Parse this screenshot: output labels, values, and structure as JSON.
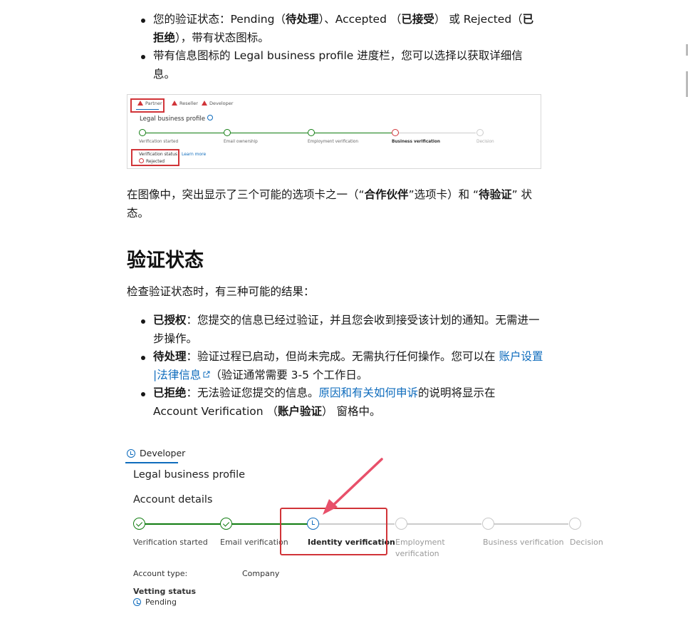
{
  "top_bullets": [
    {
      "p1": "您的验证状态：Pending（",
      "b1": "待处理",
      "p2": "）、Accepted （",
      "b2": "已接受",
      "p3": "） 或 Rejected（",
      "b3": "已拒绝",
      "p4": "），带有状态图标。"
    },
    {
      "text": "带有信息图标的 Legal business profile 进度栏，您可以选择以获取详细信息。"
    }
  ],
  "screenshot1": {
    "tabs": [
      "Partner",
      "Reseller",
      "Developer"
    ],
    "title": "Legal business profile",
    "steps": [
      "Verification started",
      "Email ownership",
      "Employment verification",
      "Business verification",
      "Decision"
    ],
    "status_label": "Verification status",
    "learn_more": "Learn more",
    "status_value": "Rejected"
  },
  "caption": {
    "p1": "在图像中，突出显示了三个可能的选项卡之一（“",
    "b1": "合作伙伴",
    "p2": "”选项卡）和 “",
    "b2": "待验证",
    "p3": "” 状态。"
  },
  "heading": "验证状态",
  "intro": "检查验证状态时，有三种可能的结果：",
  "results": [
    {
      "term": "已授权",
      "text": "：您提交的信息已经过验证，并且您会收到接受该计划的通知。无需进一步操作。"
    },
    {
      "term": "待处理",
      "text1": "：验证过程已启动，但尚未完成。无需执行任何操作。您可以在 ",
      "link": "账户设置 |法律信息",
      "text2": "（验证通常需要 3-5 个工作日。"
    },
    {
      "term": "已拒绝",
      "text1": "：无法验证您提交的信息。",
      "link": "原因和有关如何申诉",
      "text2": "的说明将显示在 Account Verification （",
      "b": "账户验证",
      "text3": "） 窗格中。"
    }
  ],
  "screenshot2": {
    "tab": "Developer",
    "title": "Legal business profile",
    "section": "Account details",
    "steps": [
      "Verification started",
      "Email verification",
      "Identity verification",
      "Employment",
      "verification",
      "Business verification",
      "Decision"
    ],
    "account_type_label": "Account type:",
    "account_type_value": "Company",
    "vetting_label": "Vetting status",
    "vetting_value": "Pending"
  },
  "colors": {
    "link": "#0f6cbd",
    "success": "#107c10",
    "highlight": "#d13438",
    "pending": "#0f6cbd"
  }
}
